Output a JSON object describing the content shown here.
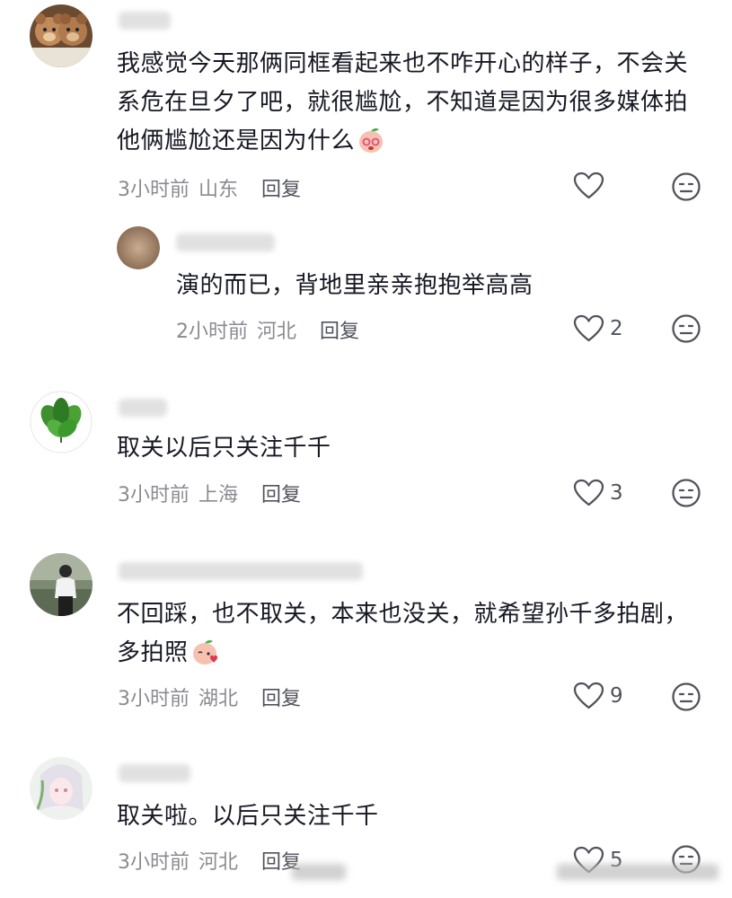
{
  "comments": [
    {
      "text": "我感觉今天那俩同框看起来也不咋开心的样子，不会关系危在旦夕了吧，就很尴尬，不知道是因为很多媒体拍他俩尴尬还是因为什么",
      "time": "3小时前",
      "location": "山东",
      "reply_label": "回复",
      "like_count": "",
      "avatar_icon": "teddy-bear-avatar",
      "emoji_icon": "peach-shy-emoji"
    },
    {
      "text": "演的而已，背地里亲亲抱抱举高高",
      "time": "2小时前",
      "location": "河北",
      "reply_label": "回复",
      "like_count": "2",
      "avatar_icon": "blurred-avatar"
    },
    {
      "text": "取关以后只关注千千",
      "time": "3小时前",
      "location": "上海",
      "reply_label": "回复",
      "like_count": "3",
      "avatar_icon": "green-leaves-avatar"
    },
    {
      "text": "不回踩，也不取关，本来也没关，就希望孙千多拍剧，多拍照",
      "time": "3小时前",
      "location": "湖北",
      "reply_label": "回复",
      "like_count": "9",
      "avatar_icon": "person-photo-avatar",
      "emoji_icon": "peach-love-emoji"
    },
    {
      "text": "取关啦。以后只关注千千",
      "time": "3小时前",
      "location": "河北",
      "reply_label": "回复",
      "like_count": "5",
      "avatar_icon": "anime-girl-avatar"
    }
  ],
  "colors": {
    "text": "#161823",
    "meta": "#8a8b91",
    "icon": "#51535c"
  }
}
